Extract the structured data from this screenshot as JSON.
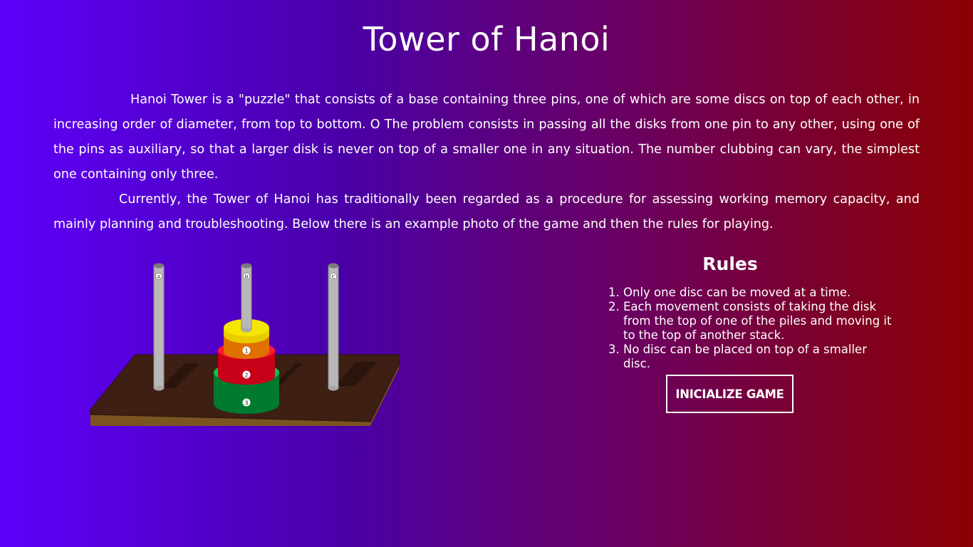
{
  "page": {
    "title": "Tower of Hanoi"
  },
  "intro": {
    "paragraphs": [
      "Hanoi Tower is a \"puzzle\" that consists of a base containing three pins, one of which are some discs on top of each other, in increasing order of diameter, from top to bottom. O The problem consists in passing all the disks from one pin to any other, using one of the pins as auxiliary, so that a larger disk is never on top of a smaller one in any situation. The number clubbing can vary, the simplest one containing only three.",
      "Currently, the Tower of Hanoi has traditionally been regarded as a procedure for assessing working memory capacity, and mainly planning and troubleshooting. Below there is an example photo of the game and then the rules for playing."
    ]
  },
  "illustration": {
    "pins": [
      "A",
      "B",
      "C"
    ],
    "disks": [
      "1",
      "2",
      "3"
    ],
    "colors": {
      "base": "#3d1f14",
      "base_edge": "#7a5520",
      "pin": "#b8b8b8",
      "disk_top": "#f5e600",
      "disk_1": "#ff8c00",
      "disk_2": "#e0001b",
      "disk_3": "#00a33c"
    }
  },
  "rules": {
    "title": "Rules",
    "items": [
      "Only one disc can be moved at a time.",
      "Each movement consists of taking the disk from the top of one of the piles and moving it to the top of another stack.",
      "No disc can be placed on top of a smaller disc."
    ]
  },
  "actions": {
    "start_label": "INICIALIZE GAME"
  }
}
